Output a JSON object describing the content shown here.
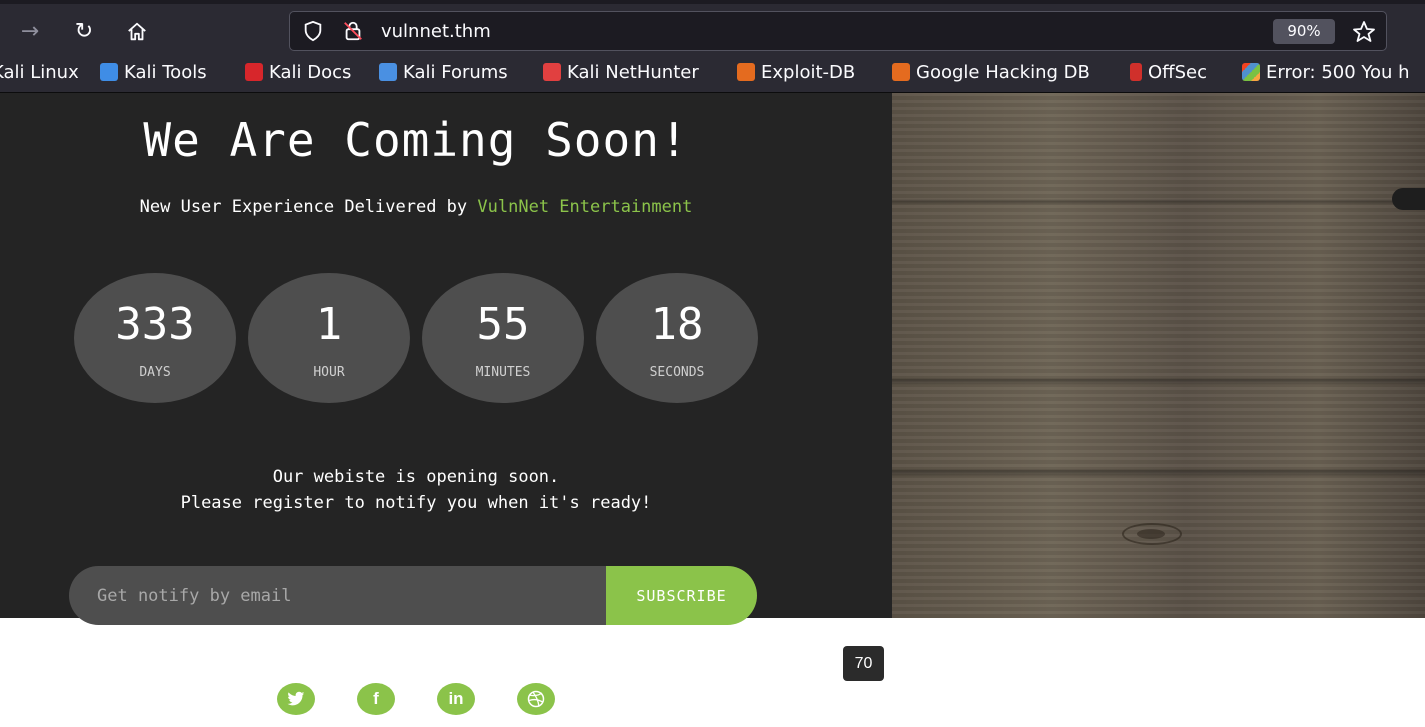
{
  "browser": {
    "url": "vulnnet.thm",
    "zoom": "90%",
    "bookmarks": [
      {
        "label": "Kali Linux",
        "icon": "kali-icon"
      },
      {
        "label": "Kali Tools",
        "icon": "kali-tools-icon"
      },
      {
        "label": "Kali Docs",
        "icon": "kali-docs-icon"
      },
      {
        "label": "Kali Forums",
        "icon": "kali-forums-icon"
      },
      {
        "label": "Kali NetHunter",
        "icon": "nethunter-icon"
      },
      {
        "label": "Exploit-DB",
        "icon": "exploit-db-icon"
      },
      {
        "label": "Google Hacking DB",
        "icon": "ghdb-icon"
      },
      {
        "label": "OffSec",
        "icon": "offsec-icon"
      },
      {
        "label": "Error: 500 You h",
        "icon": "joomla-icon"
      }
    ]
  },
  "page": {
    "headline": "We Are Coming Soon!",
    "subline_prefix": "New User Experience Delivered by ",
    "brand": "VulnNet Entertainment",
    "countdown": [
      {
        "value": "333",
        "unit": "DAYS"
      },
      {
        "value": "1",
        "unit": "HOUR"
      },
      {
        "value": "55",
        "unit": "MINUTES"
      },
      {
        "value": "18",
        "unit": "SECONDS"
      }
    ],
    "message_line1": "Our webiste is opening soon.",
    "message_line2": "Please register to notify you when it's ready!",
    "email_placeholder": "Get notify by email",
    "subscribe_label": "SUBSCRIBE",
    "tooltip": "70",
    "social": [
      "twitter-icon",
      "facebook-icon",
      "linkedin-icon",
      "dribbble-icon"
    ]
  },
  "colors": {
    "accent": "#8bc34a",
    "panel": "#242424",
    "circle": "#4e4e4e"
  }
}
